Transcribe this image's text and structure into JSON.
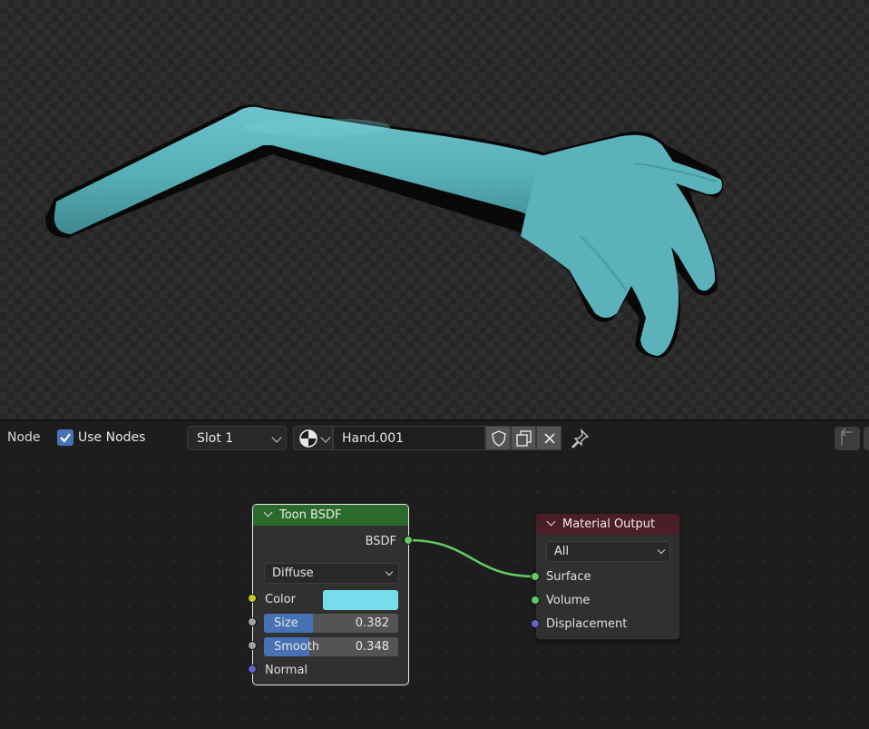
{
  "viewport": {
    "object": "arm-hand-mesh",
    "material_color": "#5ab2ba"
  },
  "header": {
    "editor_label": "Node",
    "use_nodes_label": "Use Nodes",
    "use_nodes_checked": true,
    "slot_label": "Slot 1",
    "material_name": "Hand.001"
  },
  "nodes": {
    "toon": {
      "title": "Toon BSDF",
      "header_color": "#2a6a2b",
      "output_label": "BSDF",
      "component": "Diffuse",
      "color_label": "Color",
      "color_value": "#77dcec",
      "size_label": "Size",
      "size_value": "0.382",
      "smooth_label": "Smooth",
      "smooth_value": "0.348",
      "normal_label": "Normal"
    },
    "output": {
      "title": "Material Output",
      "header_color": "#4b1d27",
      "target": "All",
      "surface_label": "Surface",
      "volume_label": "Volume",
      "displacement_label": "Displacement"
    }
  },
  "socket_colors": {
    "shader": "#63c763",
    "color": "#c7c729",
    "float": "#a1a1a1",
    "vector": "#6363c7"
  }
}
